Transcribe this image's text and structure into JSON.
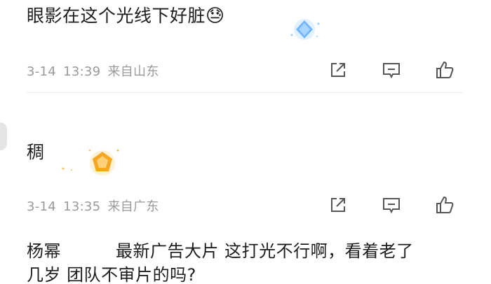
{
  "comments": [
    {
      "text": "眼影在这个光线下好脏",
      "emoji": "😓",
      "date": "3-14",
      "time": "13:39",
      "location": "来自山东"
    },
    {
      "text": "稠",
      "date": "3-14",
      "time": "13:35",
      "location": "来自广东"
    },
    {
      "author": "杨幂",
      "text_line1": "最新广告大片 这打光不行啊，看着老了",
      "text_line2": "几岁 团队不审片的吗?"
    }
  ],
  "icons": {
    "share": "share-icon",
    "comment": "comment-icon",
    "like": "like-icon"
  },
  "colors": {
    "text": "#1d1d1d",
    "meta": "#9a9a9a",
    "icon": "#555555",
    "badge_blue": "#6fb6ff",
    "badge_gold": "#f5a623"
  }
}
